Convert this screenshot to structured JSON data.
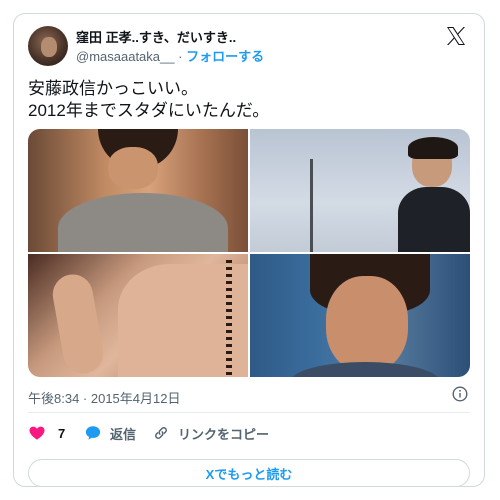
{
  "author": {
    "name": "窪田 正孝..すき、だいすき..",
    "handle": "@masaaataka__",
    "separator": "·",
    "follow_label": "フォローする"
  },
  "tweet": {
    "text": "安藤政信かっこいい。\n2012年までスタダにいたんだ。",
    "timestamp": "午後8:34 · 2015年4月12日"
  },
  "actions": {
    "like_count": "7",
    "reply_label": "返信",
    "copy_link_label": "リンクをコピー"
  },
  "read_more_label": "Xでもっと読む",
  "colors": {
    "accent": "#1d9bf0",
    "like": "#f91880",
    "text": "#0f1419",
    "secondary": "#536471",
    "border": "#cfd9de"
  },
  "icons": {
    "brand": "x-logo-icon",
    "info": "info-icon",
    "like": "heart-icon",
    "reply": "speech-bubble-icon",
    "link": "link-icon"
  }
}
